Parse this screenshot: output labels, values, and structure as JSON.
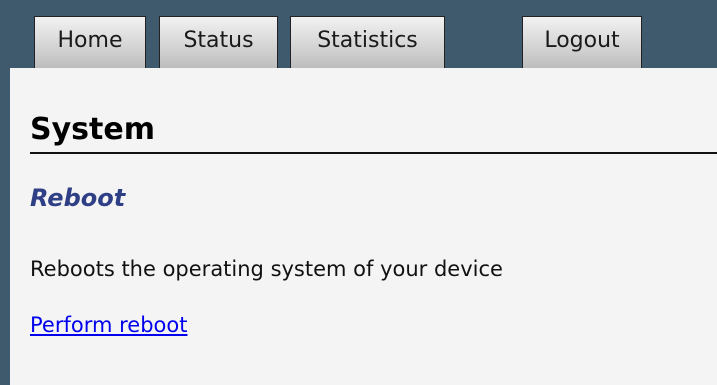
{
  "tabs": {
    "home": "Home",
    "status": "Status",
    "statistics": "Statistics",
    "logout": "Logout"
  },
  "page": {
    "title": "System",
    "section_title": "Reboot",
    "description": "Reboots the operating system of your device",
    "reboot_link": "Perform reboot"
  },
  "colors": {
    "background": "#3f5a6d",
    "content_background": "#f4f4f4",
    "section_title": "#2f3f86",
    "link": "#0000ee"
  }
}
